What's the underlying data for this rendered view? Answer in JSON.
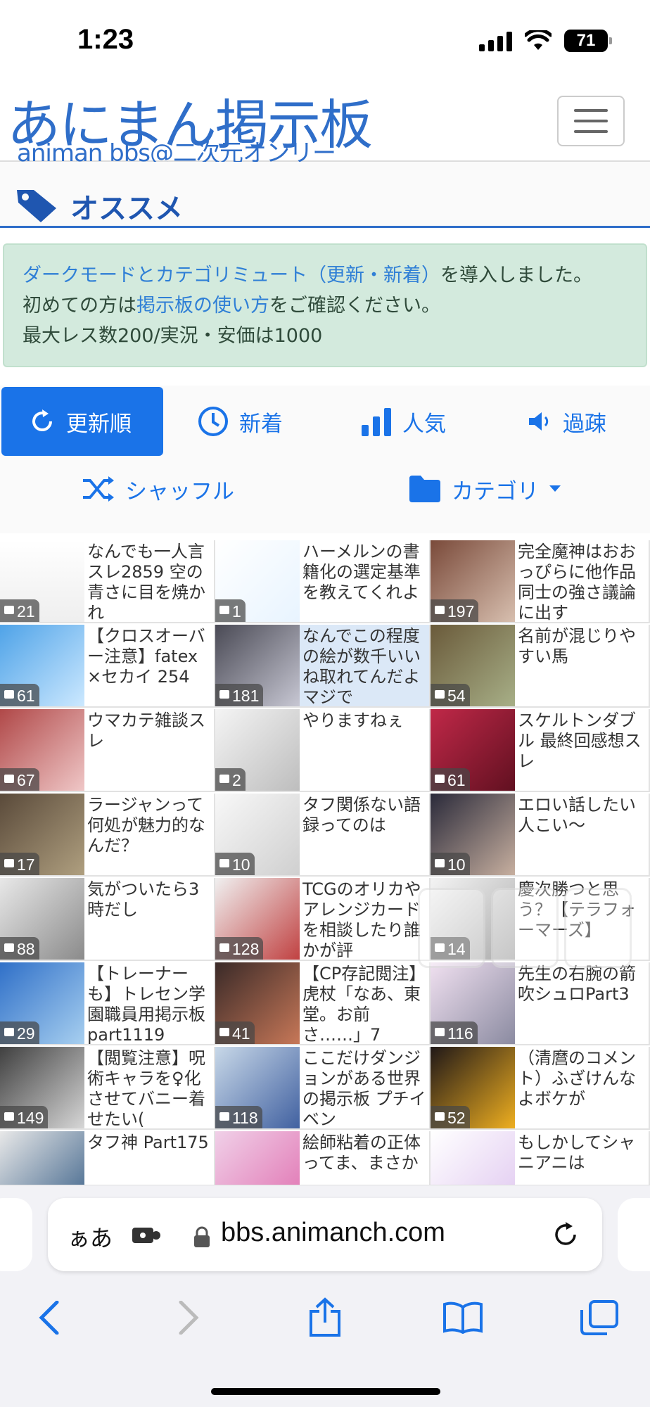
{
  "status": {
    "time": "1:23",
    "battery": "71"
  },
  "header": {
    "logo": "あにまん掲示板",
    "logo_sub": "animan bbs@二次元オンリー"
  },
  "section": {
    "title": "オススメ"
  },
  "notice": {
    "line1_link": "ダークモードとカテゴリミュート（更新・新着）",
    "line1_rest": "を導入しました。",
    "line2_pre": "初めての方は",
    "line2_link": "掲示板の使い方",
    "line2_rest": "をご確認ください。",
    "line3": "最大レス数200/実況・安価は1000"
  },
  "sort_tabs": [
    {
      "label": "更新順",
      "icon": "refresh-icon",
      "active": true
    },
    {
      "label": "新着",
      "icon": "clock-icon"
    },
    {
      "label": "人気",
      "icon": "bar-chart-icon"
    },
    {
      "label": "過疎",
      "icon": "speaker-icon"
    },
    {
      "label": "シャッフル",
      "icon": "shuffle-icon"
    },
    {
      "label": "カテゴリ",
      "icon": "folder-icon"
    }
  ],
  "threads": [
    {
      "title": "なんでも一人言スレ2859 空の青さに目を焼かれ",
      "count": "21"
    },
    {
      "title": "ハーメルンの書籍化の選定基準を教えてくれよ",
      "count": "1"
    },
    {
      "title": "完全魔神はおおっぴらに他作品同士の強さ議論に出す",
      "count": "197"
    },
    {
      "title": "【クロスオーバー注意】fatex×セカイ 254",
      "count": "61"
    },
    {
      "title": "なんでこの程度の絵が数千いいね取れてんだよマジで",
      "count": "181"
    },
    {
      "title": "名前が混じりやすい馬",
      "count": "54"
    },
    {
      "title": "ウマカテ雑談スレ",
      "count": "67"
    },
    {
      "title": "やりますねぇ",
      "count": "2"
    },
    {
      "title": "スケルトンダブル 最終回感想スレ",
      "count": "61"
    },
    {
      "title": "ラージャンって何処が魅力的なんだ？",
      "count": "17"
    },
    {
      "title": "タフ関係ない語録ってのは",
      "count": "10"
    },
    {
      "title": "エロい話したい人こい〜",
      "count": "10"
    },
    {
      "title": "気がついたら3時だし",
      "count": "88"
    },
    {
      "title": "TCGのオリカやアレンジカードを相談したり誰かが評",
      "count": "128"
    },
    {
      "title": "慶次勝つと思う？【テラフォーマーズ】",
      "count": "14"
    },
    {
      "title": "【トレーナーも】トレセン学園職員用掲示板part1119",
      "count": "29"
    },
    {
      "title": "【CP存記閲注】虎杖「なあ、東堂。お前さ……」7",
      "count": "41"
    },
    {
      "title": "先生の右腕の箭吹シュロPart3",
      "count": "116"
    },
    {
      "title": "【閲覧注意】呪術キャラを♀化させてバニー着せたい(",
      "count": "149"
    },
    {
      "title": "ここだけダンジョンがある世界の掲示板 プチイベン",
      "count": "118"
    },
    {
      "title": "（清麿のコメント）ふざけんなよボケが",
      "count": "52"
    },
    {
      "title": "タフ神 Part175",
      "count": ""
    },
    {
      "title": "絵師粘着の正体ってま、まさか",
      "count": ""
    },
    {
      "title": "もしかしてシャニアニは",
      "count": ""
    }
  ],
  "browser": {
    "aa": "ぁあ",
    "url": "bbs.animanch.com"
  },
  "colors": {
    "accent": "#1a73e8",
    "logo": "#2f6ec9",
    "notice_bg": "#d3eadd"
  }
}
